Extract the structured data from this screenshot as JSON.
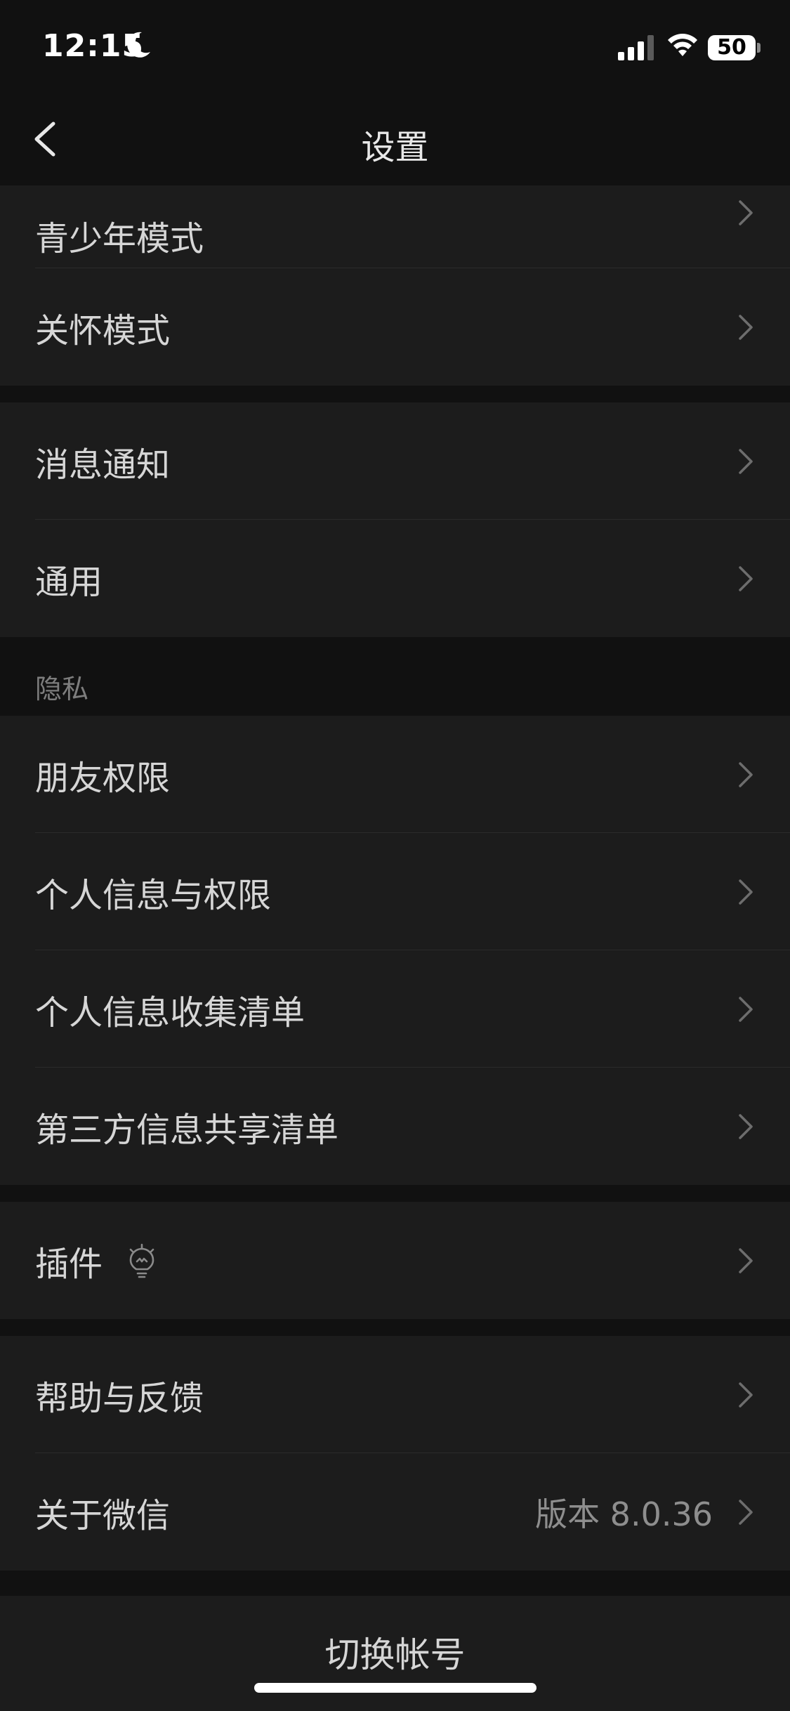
{
  "status_bar": {
    "time": "12:15",
    "battery": "50"
  },
  "header": {
    "title": "设置"
  },
  "group1": {
    "items": [
      {
        "label": "青少年模式"
      },
      {
        "label": "关怀模式"
      }
    ]
  },
  "group2": {
    "items": [
      {
        "label": "消息通知"
      },
      {
        "label": "通用"
      }
    ]
  },
  "privacy": {
    "header": "隐私",
    "items": [
      {
        "label": "朋友权限"
      },
      {
        "label": "个人信息与权限"
      },
      {
        "label": "个人信息收集清单"
      },
      {
        "label": "第三方信息共享清单"
      }
    ]
  },
  "group4": {
    "items": [
      {
        "label": "插件",
        "icon": "lightbulb-icon"
      }
    ]
  },
  "group5": {
    "items": [
      {
        "label": "帮助与反馈"
      },
      {
        "label": "关于微信",
        "value": "版本 8.0.36"
      }
    ]
  },
  "footer": {
    "switch_account": "切换帐号"
  },
  "colors": {
    "background": "#111111",
    "cell": "#1c1c1c",
    "text": "#d6d6d6",
    "secondary": "#8e8e8e"
  }
}
